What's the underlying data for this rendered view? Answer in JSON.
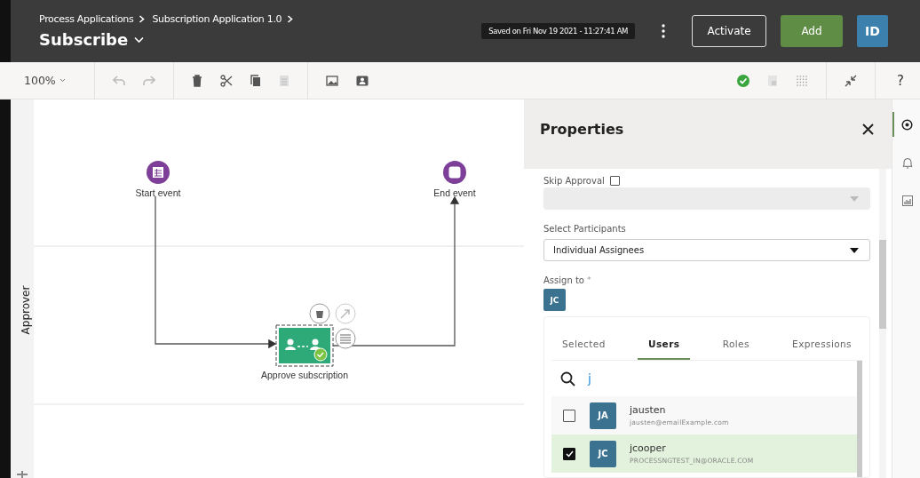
{
  "header": {
    "breadcrumbs": [
      "Process Applications",
      "Subscription Application 1.0"
    ],
    "title": "Subscribe",
    "saved": "Saved on Fri Nov 19 2021 - 11:27:41 AM",
    "buttons": [
      {
        "label": "Activate",
        "kind": "outline"
      },
      {
        "label": "Add",
        "kind": "primary"
      }
    ],
    "avatar": "ID"
  },
  "toolbar": {
    "zoom": "100%",
    "help": "?"
  },
  "canvas": {
    "lane": "Approver",
    "nodes": [
      {
        "kind": "start",
        "label": "Start event"
      },
      {
        "kind": "end",
        "label": "End event"
      },
      {
        "kind": "task",
        "label": "Approve subscription",
        "selected": true
      }
    ]
  },
  "properties": {
    "title": "Properties",
    "skip_approval": {
      "label": "Skip Approval",
      "checked": false
    },
    "participants": {
      "label": "Select Participants",
      "value": "Individual Assignees"
    },
    "assign_to": {
      "label": "Assign to",
      "required_mark": "*",
      "chips": [
        "JC"
      ]
    },
    "tabs": [
      {
        "label": "Selected",
        "selected": false
      },
      {
        "label": "Users",
        "selected": true
      },
      {
        "label": "Roles",
        "selected": false
      },
      {
        "label": "Expressions",
        "selected": false
      }
    ],
    "search": {
      "value": "j"
    },
    "users": [
      {
        "initials": "JA",
        "name": "jausten",
        "email": "jausten@emailExample.com",
        "checked": false
      },
      {
        "initials": "JC",
        "name": "jcooper",
        "email": "PROCESSNGTEST_IN@ORACLE.COM",
        "checked": true
      }
    ]
  },
  "rail": [
    {
      "kind": "settings",
      "selected": true
    },
    {
      "kind": "bell",
      "selected": false
    },
    {
      "kind": "chart",
      "selected": false
    }
  ]
}
